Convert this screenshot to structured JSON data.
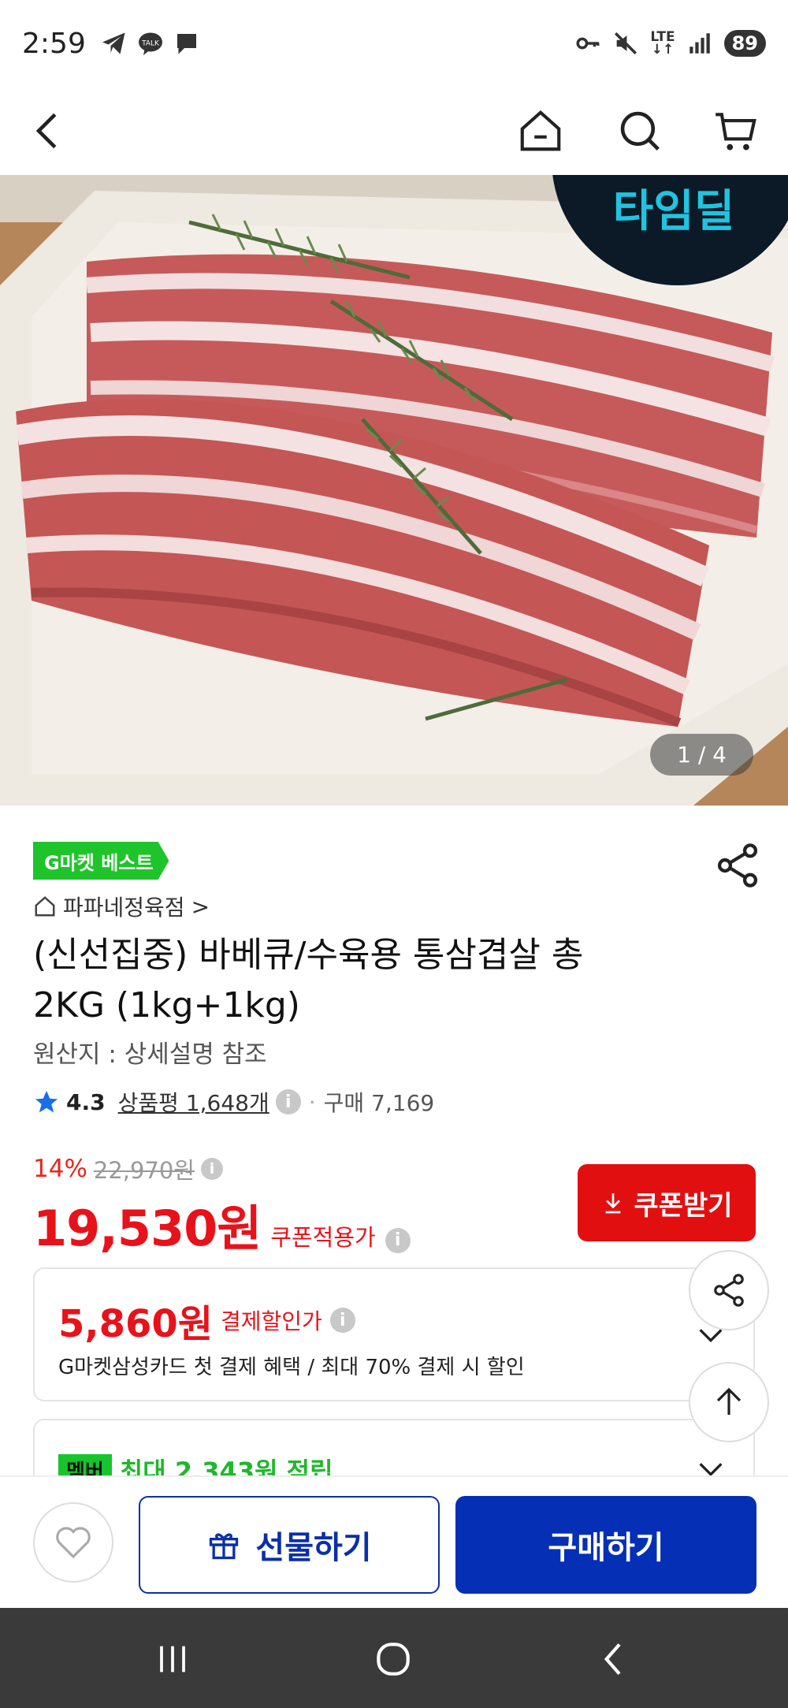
{
  "status_bar": {
    "time": "2:59",
    "network_line1": "LTE",
    "network_line2": "↓↑",
    "battery": "89"
  },
  "nav": {
    "icons": [
      "back-icon",
      "home-icon",
      "search-icon",
      "cart-icon"
    ]
  },
  "hero": {
    "badge_text": "타임딜",
    "pager": "1 / 4"
  },
  "product": {
    "badge": "G마켓 베스트",
    "shop_name": "파파네정육점",
    "shop_chevron": ">",
    "title": "(신선집중) 바베큐/수육용 통삼겹살 총 2KG (1kg+1kg)",
    "origin": "원산지 : 상세설명 참조",
    "rating": "4.3",
    "review_label": "상품평 1,648개",
    "separator": "·",
    "purchase_count": "구매 7,169",
    "info_glyph": "i"
  },
  "price": {
    "discount_pct": "14%",
    "original_price": "22,970원",
    "sale_price": "19,530원",
    "sale_label": "쿠폰적용가",
    "coupon_button": "쿠폰받기"
  },
  "benefits": {
    "card_amount": "5,860원",
    "card_label": "결제할인가",
    "card_desc": "G마켓삼성카드 첫 결제 혜택 / 최대 70% 결제 시 할인",
    "member_tag": "멤버",
    "member_text": "최대 2,343원 적립"
  },
  "actions": {
    "gift": "선물하기",
    "buy": "구매하기"
  },
  "colors": {
    "accent_red": "#e8121a",
    "coupon_red": "#e20f11",
    "buy_blue": "#0530b5",
    "best_green": "#1fc42b"
  }
}
